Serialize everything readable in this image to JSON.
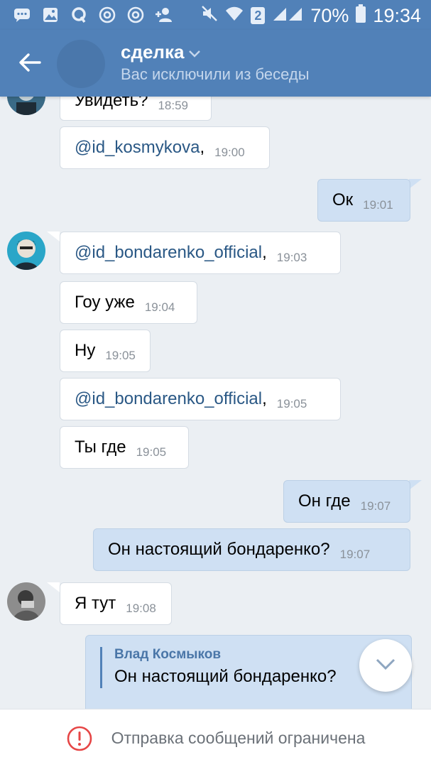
{
  "status_bar": {
    "left_icons": [
      "chat-bubble-icon",
      "image-icon",
      "q-icon",
      "at-icon",
      "at-icon",
      "add-user-icon"
    ],
    "sim_badge": "2",
    "battery": "70%",
    "time": "19:34"
  },
  "header": {
    "title": "сделка",
    "subtitle": "Вас исключили из беседы"
  },
  "messages": [
    {
      "text": "Увидеть?",
      "time": "18:59"
    },
    {
      "mention": "@id_kosmykova",
      "suffix": ",",
      "time": "19:00"
    },
    {
      "text": "Ок",
      "time": "19:01"
    },
    {
      "mention": "@id_bondarenko_official",
      "suffix": ",",
      "time": "19:03"
    },
    {
      "text": "Гоу уже",
      "time": "19:04"
    },
    {
      "text": "Ну",
      "time": "19:05"
    },
    {
      "mention": "@id_bondarenko_official",
      "suffix": ",",
      "time": "19:05"
    },
    {
      "text": "Ты где",
      "time": "19:05"
    },
    {
      "text": "Он где",
      "time": "19:07"
    },
    {
      "text": "Он настоящий бондаренко?",
      "time": "19:07"
    },
    {
      "text": "Я тут",
      "time": "19:08"
    }
  ],
  "reply": {
    "author": "Влад Космыков",
    "text": "Он настоящий бондаренко?"
  },
  "bottom_bar": {
    "text": "Отправка сообщений ограничена",
    "icon": "exclamation-circle-icon"
  },
  "colors": {
    "header": "#5181b8",
    "background": "#ebeff3",
    "outgoing": "#cfe0f3",
    "incoming": "#ffffff",
    "mention": "#2a5885",
    "warning": "#e64646"
  }
}
